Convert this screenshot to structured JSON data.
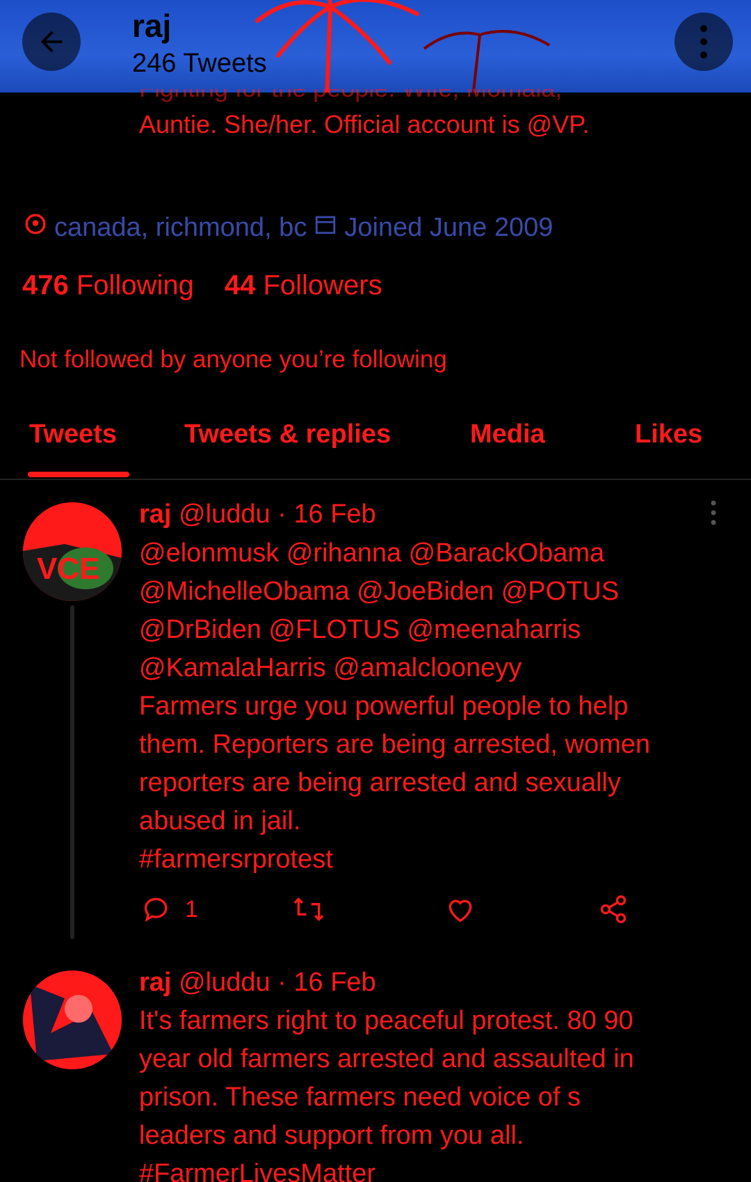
{
  "header": {
    "title": "raj",
    "subtitle": "246 Tweets"
  },
  "bio": {
    "cut_line": "Fighting for the people. Wife, Momala,",
    "line": "Auntie. She/her. Official account is @VP."
  },
  "meta": {
    "location": "canada, richmond, bc",
    "joined": "Joined June 2009"
  },
  "stats": {
    "following_count": "476",
    "following_label": "Following",
    "followers_count": "44",
    "followers_label": "Followers"
  },
  "not_followed": "Not followed by anyone you’re following",
  "tabs": [
    "Tweets",
    "Tweets & replies",
    "Media",
    "Likes"
  ],
  "tweets": [
    {
      "name": "raj",
      "meta": "@luddu · 16 Feb",
      "text": "@elonmusk @rihanna @BarackObama\n@MichelleObama @JoeBiden @POTUS\n@DrBiden @FLOTUS @meenaharris\n@KamalaHarris @amalclooneyy\nFarmers urge you powerful people to help\nthem. Reporters are being arrested, women\nreporters are being arrested and sexually\nabused in jail.\n#farmersrprotest",
      "reply_count": "1"
    },
    {
      "name": "raj",
      "meta": "@luddu · 16 Feb",
      "text": "It's farmers right to peaceful protest. 80 90\nyear old farmers arrested and assaulted in\nprison. These farmers need voice of s\nleaders and support from you all.\n#FarmerLivesMatter"
    }
  ],
  "colors": {
    "accent": "#ff1a1a",
    "header_bg": "#2a5fd8",
    "background": "#000000",
    "meta_text": "#3a4aa8"
  }
}
